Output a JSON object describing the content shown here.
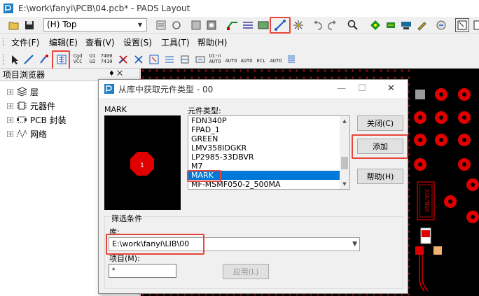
{
  "window": {
    "title": "E:\\work\\fanyi\\PCB\\04.pcb* - PADS Layout"
  },
  "toolbar": {
    "layer_select": "(H) Top"
  },
  "menu": {
    "items": [
      "文件(F)",
      "编辑(E)",
      "查看(V)",
      "设置(S)",
      "工具(T)",
      "帮助(H)"
    ]
  },
  "toolbar2": {
    "labels": {
      "cgnd_top": "Cgd",
      "cgnd_bot": "VCC",
      "u1u2_top": "U1",
      "u1u2_bot": "U2",
      "n7410_top": "7400",
      "n7410_bot": "7410",
      "u1n_top": "U1-n",
      "u1n_bot": "AUTO",
      "auto1": "AUTO",
      "auto2": "AUTO",
      "ecl": "ECL",
      "auto3": "AUTO"
    }
  },
  "panel": {
    "title": "项目浏览器",
    "pin": "♦ ⨉",
    "tree": [
      {
        "label": "层",
        "icon": "layers-icon"
      },
      {
        "label": "元器件",
        "icon": "component-icon"
      },
      {
        "label": "PCB 封装",
        "icon": "footprint-icon"
      },
      {
        "label": "网络",
        "icon": "net-icon"
      }
    ]
  },
  "pcb": {
    "silk_label": "USB/VCC"
  },
  "dialog": {
    "title": "从库中获取元件类型 - 00",
    "preview_label": "MARK",
    "preview_pad_number": "1",
    "part_types_label": "元件类型:",
    "part_types": [
      "FDN340P",
      "FPAD_1",
      "GREEN",
      "LMV358IDGKR",
      "LP2985-33DBVR",
      "M7",
      "MARK",
      "MF-MSMF050-2_500MA"
    ],
    "selected_part": "MARK",
    "buttons": {
      "close": "关闭(C)",
      "add": "添加",
      "help": "帮助(H)",
      "apply": "应用(L)"
    },
    "filter": {
      "group_title": "筛选条件",
      "library_label": "库:",
      "library_value": "E:\\work\\fanyi\\LIB\\00",
      "items_label": "项目(M):",
      "items_value": "*"
    }
  },
  "colors": {
    "highlight_box": "#e6473b",
    "selection": "#0078d7",
    "pad_red": "#e00000",
    "pcb_bg": "#000000"
  }
}
